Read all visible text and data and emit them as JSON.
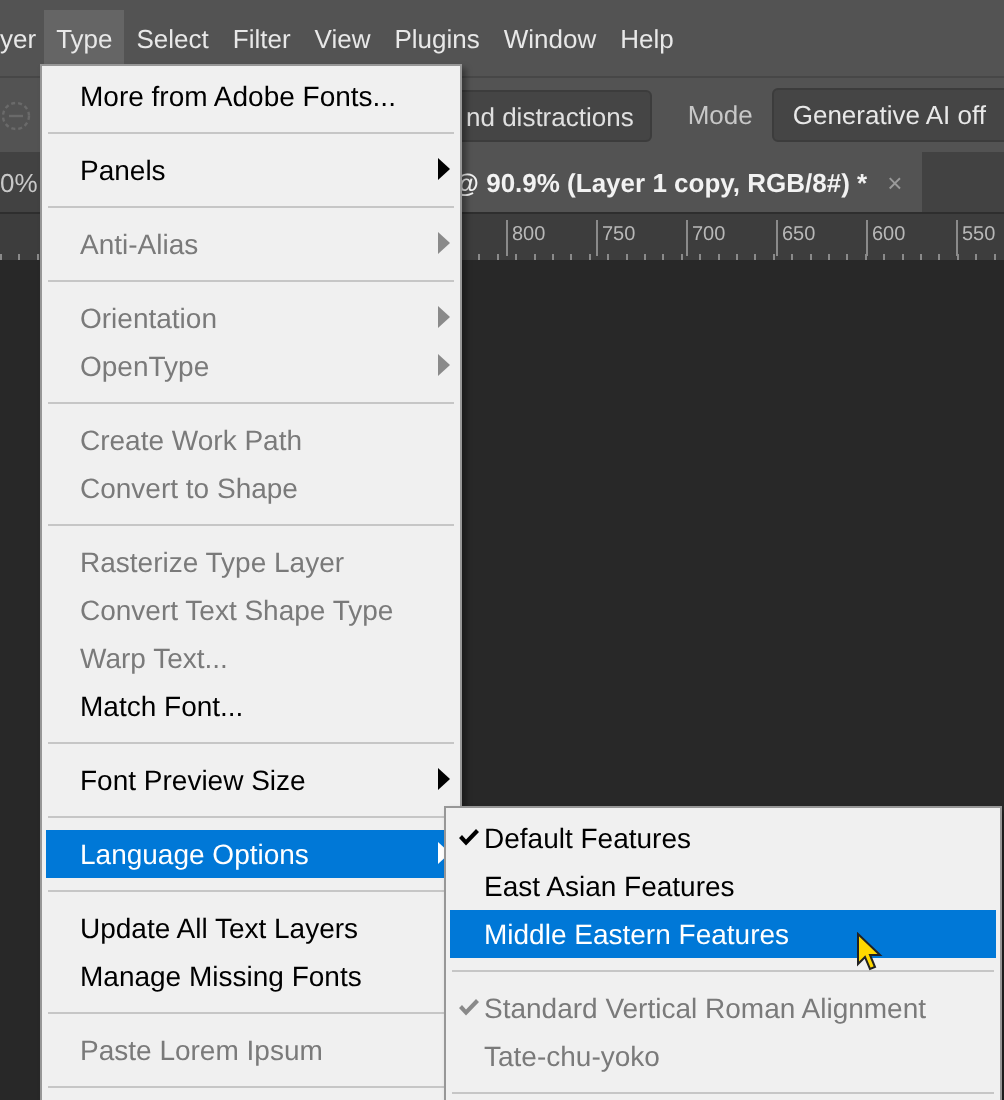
{
  "menubar": [
    {
      "label": "yer",
      "selected": false
    },
    {
      "label": "Type",
      "selected": true
    },
    {
      "label": "Select",
      "selected": false
    },
    {
      "label": "Filter",
      "selected": false
    },
    {
      "label": "View",
      "selected": false
    },
    {
      "label": "Plugins",
      "selected": false
    },
    {
      "label": "Window",
      "selected": false
    },
    {
      "label": "Help",
      "selected": false
    }
  ],
  "options_bar": {
    "button": "nd distractions",
    "mode_label": "Mode",
    "mode_select": "Generative AI off"
  },
  "document_tabs": [
    {
      "label": "0%",
      "selected": false
    },
    {
      "label": "@ 90.9% (Layer 1 copy, RGB/8#) *",
      "selected": true,
      "close": "×"
    }
  ],
  "ruler": [
    "800",
    "750",
    "700",
    "650",
    "600",
    "550"
  ],
  "type_menu": [
    {
      "kind": "item",
      "label": "More from Adobe Fonts...",
      "disabled": false,
      "submenu": false,
      "selected": false
    },
    {
      "kind": "separator"
    },
    {
      "kind": "item",
      "label": "Panels",
      "disabled": false,
      "submenu": true,
      "selected": false
    },
    {
      "kind": "separator"
    },
    {
      "kind": "item",
      "label": "Anti-Alias",
      "disabled": true,
      "submenu": true,
      "selected": false
    },
    {
      "kind": "separator"
    },
    {
      "kind": "item",
      "label": "Orientation",
      "disabled": true,
      "submenu": true,
      "selected": false
    },
    {
      "kind": "item",
      "label": "OpenType",
      "disabled": true,
      "submenu": true,
      "selected": false
    },
    {
      "kind": "separator"
    },
    {
      "kind": "item",
      "label": "Create Work Path",
      "disabled": true,
      "submenu": false,
      "selected": false
    },
    {
      "kind": "item",
      "label": "Convert to Shape",
      "disabled": true,
      "submenu": false,
      "selected": false
    },
    {
      "kind": "separator"
    },
    {
      "kind": "item",
      "label": "Rasterize Type Layer",
      "disabled": true,
      "submenu": false,
      "selected": false
    },
    {
      "kind": "item",
      "label": "Convert Text Shape Type",
      "disabled": true,
      "submenu": false,
      "selected": false
    },
    {
      "kind": "item",
      "label": "Warp Text...",
      "disabled": true,
      "submenu": false,
      "selected": false
    },
    {
      "kind": "item",
      "label": "Match Font...",
      "disabled": false,
      "submenu": false,
      "selected": false
    },
    {
      "kind": "separator"
    },
    {
      "kind": "item",
      "label": "Font Preview Size",
      "disabled": false,
      "submenu": true,
      "selected": false
    },
    {
      "kind": "separator"
    },
    {
      "kind": "item",
      "label": "Language Options",
      "disabled": false,
      "submenu": true,
      "selected": true
    },
    {
      "kind": "separator"
    },
    {
      "kind": "item",
      "label": "Update All Text Layers",
      "disabled": false,
      "submenu": false,
      "selected": false
    },
    {
      "kind": "item",
      "label": "Manage Missing Fonts",
      "disabled": false,
      "submenu": false,
      "selected": false
    },
    {
      "kind": "separator"
    },
    {
      "kind": "item",
      "label": "Paste Lorem Ipsum",
      "disabled": true,
      "submenu": false,
      "selected": false
    },
    {
      "kind": "separator"
    }
  ],
  "language_submenu": [
    {
      "kind": "item",
      "label": "Default Features",
      "checked": true,
      "disabled": false,
      "selected": false
    },
    {
      "kind": "item",
      "label": "East Asian Features",
      "checked": false,
      "disabled": false,
      "selected": false
    },
    {
      "kind": "item",
      "label": "Middle Eastern Features",
      "checked": false,
      "disabled": false,
      "selected": true
    },
    {
      "kind": "separator"
    },
    {
      "kind": "item",
      "label": "Standard Vertical Roman Alignment",
      "checked": true,
      "disabled": true,
      "selected": false
    },
    {
      "kind": "item",
      "label": "Tate-chu-yoko",
      "checked": false,
      "disabled": true,
      "selected": false
    },
    {
      "kind": "separator"
    }
  ]
}
